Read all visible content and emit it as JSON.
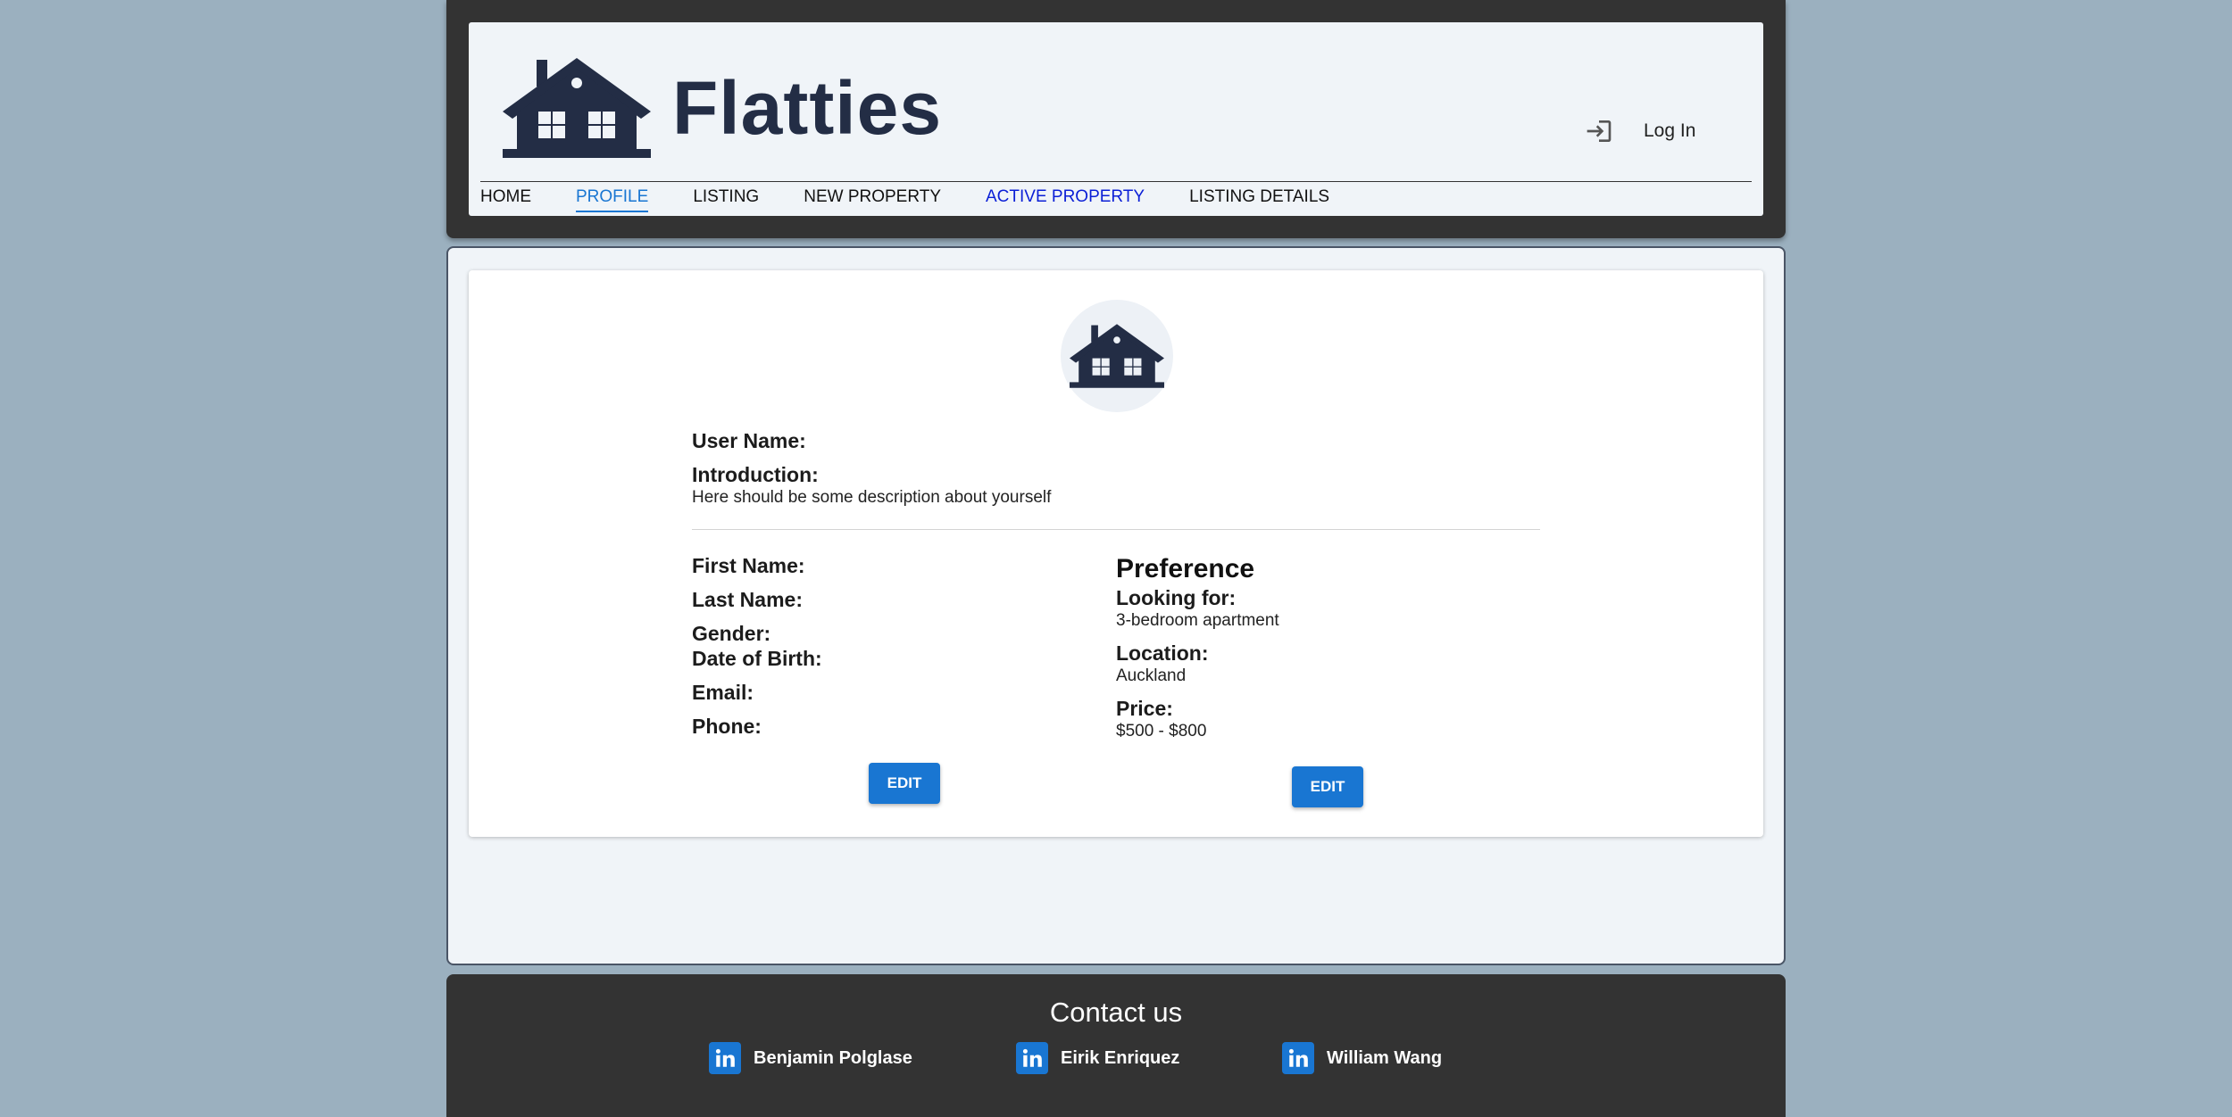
{
  "header": {
    "app_title": "Flatties",
    "login_label": "Log In",
    "nav": [
      {
        "label": "HOME"
      },
      {
        "label": "PROFILE"
      },
      {
        "label": "LISTING"
      },
      {
        "label": "NEW PROPERTY"
      },
      {
        "label": "ACTIVE PROPERTY"
      },
      {
        "label": "LISTING DETAILS"
      }
    ],
    "active_nav": "PROFILE"
  },
  "profile": {
    "user_name_label": "User Name:",
    "introduction_label": "Introduction:",
    "introduction_text": "Here should be some description about yourself",
    "first_name_label": "First Name:",
    "last_name_label": "Last Name:",
    "gender_label": "Gender:",
    "dob_label": "Date of Birth:",
    "email_label": "Email:",
    "phone_label": "Phone:",
    "edit_label": "EDIT"
  },
  "preference": {
    "title": "Preference",
    "looking_for_label": "Looking for:",
    "looking_for_value": "3-bedroom apartment",
    "location_label": "Location:",
    "location_value": "Auckland",
    "price_label": "Price:",
    "price_value": "$500 - $800",
    "edit_label": "EDIT"
  },
  "footer": {
    "title": "Contact us",
    "contacts": [
      {
        "name": "Benjamin Polglase",
        "icon": "linkedin-icon"
      },
      {
        "name": "Eirik Enriquez",
        "icon": "linkedin-icon"
      },
      {
        "name": "William Wang",
        "icon": "linkedin-icon"
      }
    ]
  },
  "colors": {
    "background": "#9bb0bf",
    "frame": "#333333",
    "card": "#f0f4f8",
    "accent": "#1976d2",
    "brand": "#232d45",
    "active_property_link": "#0b1fd6"
  }
}
